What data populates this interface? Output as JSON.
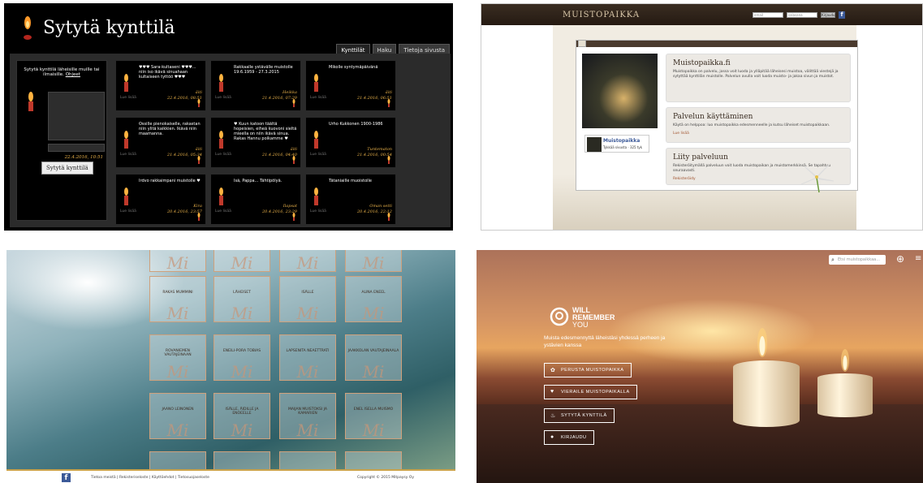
{
  "s1": {
    "title": "Sytytä kynttilä",
    "tabs": [
      "Kynttilät",
      "Haku",
      "Tietoja sivusta"
    ],
    "intro": "Sytytä kynttilä läheisille muille tai",
    "intro2": "ilmaisille.",
    "intro_link": "Ohjeet",
    "left_date": "22.4.2016, 10:51",
    "light_button": "Sytytä kynttilä",
    "more": "Lue lisää",
    "cards": [
      {
        "msg": "♥♥♥ Sara-kultaseni ♥♥♥... niin iso ikävä sinuahaan kultaiseen tyttöö ♥♥♥",
        "auth": "äiti",
        "date": "22.4.2016, 08:51"
      },
      {
        "msg": "Rakkaalle ystävälle muistolle 19.6.1959 - 27.3.2015",
        "auth": "Heikka",
        "date": "21.4.2016, 07:29"
      },
      {
        "msg": "Mikolle syntymäpäivänä",
        "auth": "äiti",
        "date": "21.4.2016, 06:51"
      },
      {
        "msg": "Ossille pienokaiselle, rakastan niin ylitä kaikkien. Ikävä niin maamanna.",
        "auth": "äiti",
        "date": "21.4.2016, 05:34"
      },
      {
        "msg": "♥ Kuun katoon täältä hopeisien, eiheä kuovoni sieltä mieella on niin ikävä sinua. Rakas Hannu poikamme ♥",
        "auth": "äiti",
        "date": "21.4.2016, 04:40"
      },
      {
        "msg": "Urho Kukkonen 1900-1986",
        "auth": "Tuntematon",
        "date": "21.4.2016, 00:54"
      },
      {
        "msg": "Irdvo rakkaimpani muistolle ♥",
        "auth": "Kira",
        "date": "20.4.2016, 23:57"
      },
      {
        "msg": "Isä, Pappa... Tähtipölyä.",
        "auth": "Ilapsat",
        "date": "20.4.2016, 23:29"
      },
      {
        "msg": "Tätaniaille muoistolle",
        "auth": "Oman setti",
        "date": "20.4.2016, 22:12"
      }
    ]
  },
  "s2": {
    "brand": "MUISTOPAIKKA",
    "login_email": "email",
    "login_password": "salasana",
    "login_button": "Kirjaudu",
    "fb_title": "Muistopaikka",
    "fb_like": "Tykkää sivusta  · 325 tyk",
    "blocks": [
      {
        "title": "Muistopaikka.fi",
        "text": "Muistopaikka on palvelu, jossa voit luoda ja ylläpitää läheisesi muistoa, välittää viestejä ja sytyttää kynttilän muistolle. Palvelun avulla voit luoda muisto- ja jakaa sivun ja muistot.",
        "link": ""
      },
      {
        "title": "Palvelun käyttäminen",
        "text": "Käytä on helppoa: luo muistopaikka edesmenneelle ja kutsu läheiset muistopaikkaan.",
        "link": "Lue lisää"
      },
      {
        "title": "Liity palveluun",
        "text": "Rekisteröitymällä palveluun voit luoda muistopaikan ja muistomerkkinsä. Se tapahtuu seuraavasti.",
        "link": "Rekisteröidy"
      }
    ]
  },
  "s3": {
    "tiles": [
      "RAKAS MUMMINI",
      "LÄHEISET",
      "ISÄLLE",
      "ALINA ENEEL",
      "ROVANIEMEN VAUTAJEINAAN",
      "ENEILI-PORA TOBIAS",
      "LAPSENITA NEAETTRATI",
      "JAAKKOLAN VAUTAJEINAALA",
      "JAANO LEINONEN",
      "ISÄLLE, ÄIDILLE JA ENOEELLE",
      "MAIJAN MUISTOKSI JA KAMARIEN",
      "ENEL ISELLA MUISMO"
    ],
    "tile_mark": "Mi",
    "footer_fb": "f",
    "footer_links": "Tietoa meistä  |  Rekisteriseloste  |  Käyttöehdot  |  Tietosuojaseloste",
    "copyright": "Copyright © 2015 Mitpaysy Oy"
  },
  "s4": {
    "search_placeholder": "Etsi muistopaikkaa...",
    "brand_line1": "WILL",
    "brand_line2": "REMEMBER",
    "brand_line3": "YOU",
    "tagline": "Muista edesmennyttä läheistäsi yhdessä perheen ja ystävien kanssa",
    "buttons": [
      "PERUSTA MUISTOPAIKKA",
      "VIERAILE MUISTOPAIKALLA",
      "SYTYTÄ KYNTTILÄ",
      "KIRJAUDU"
    ]
  }
}
